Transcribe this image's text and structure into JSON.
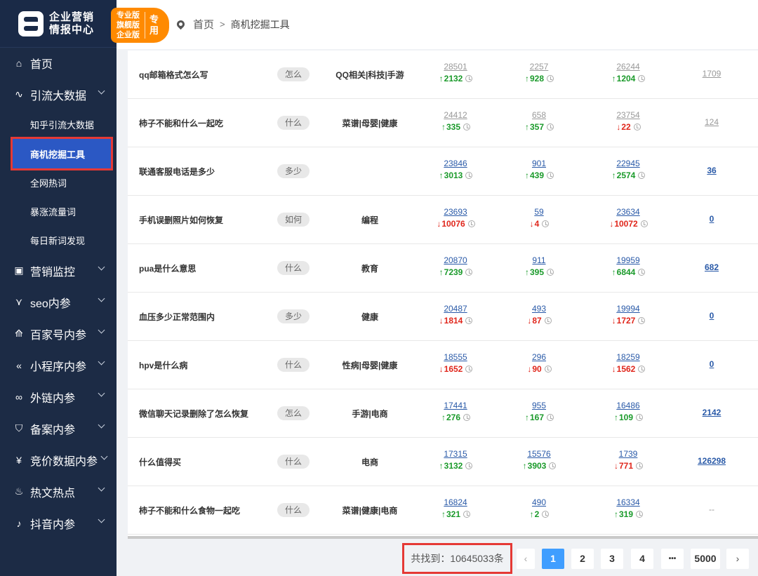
{
  "brand": {
    "line1": "企业营销",
    "line2": "情报中心",
    "edition_lines": [
      "专业版",
      "旗舰版",
      "企业版"
    ],
    "edition_label": "专用"
  },
  "breadcrumb": {
    "home": "首页",
    "separator": ">",
    "current": "商机挖掘工具"
  },
  "sidebar": {
    "home": {
      "label": "首页",
      "icon": "home-icon"
    },
    "group1": {
      "label": "引流大数据",
      "icon": "pulse-icon",
      "subitems": [
        "知乎引流大数据",
        "商机挖掘工具",
        "全网热词",
        "暴涨流量词",
        "每日新词发现"
      ]
    },
    "groups": [
      {
        "label": "营销监控",
        "icon": "monitor-icon"
      },
      {
        "label": "seo内参",
        "icon": "seo-icon"
      },
      {
        "label": "百家号内参",
        "icon": "baijia-icon"
      },
      {
        "label": "小程序内参",
        "icon": "miniapp-icon"
      },
      {
        "label": "外链内参",
        "icon": "link-icon"
      },
      {
        "label": "备案内参",
        "icon": "shield-icon"
      },
      {
        "label": "竞价数据内参",
        "icon": "yuan-icon"
      },
      {
        "label": "热文热点",
        "icon": "fire-icon"
      },
      {
        "label": "抖音内参",
        "icon": "douyin-icon"
      }
    ]
  },
  "rows": [
    {
      "keyword": "qq邮箱格式怎么写",
      "tag": "怎么",
      "category": "QQ相关|科技|手游",
      "m1": "28501",
      "d1": "2132",
      "d1dir": "up",
      "m2": "2257",
      "d2": "928",
      "d2dir": "up",
      "m3": "26244",
      "d3": "1204",
      "d3dir": "up",
      "last": "1709",
      "grey": true
    },
    {
      "keyword": "柿子不能和什么一起吃",
      "tag": "什么",
      "category": "菜谱|母婴|健康",
      "m1": "24412",
      "d1": "335",
      "d1dir": "up",
      "m2": "658",
      "d2": "357",
      "d2dir": "up",
      "m3": "23754",
      "d3": "22",
      "d3dir": "down",
      "last": "124",
      "grey": true
    },
    {
      "keyword": "联通客服电话是多少",
      "tag": "多少",
      "category": "",
      "m1": "23846",
      "d1": "3013",
      "d1dir": "up",
      "m2": "901",
      "d2": "439",
      "d2dir": "up",
      "m3": "22945",
      "d3": "2574",
      "d3dir": "up",
      "last": "36",
      "grey": false
    },
    {
      "keyword": "手机误删照片如何恢复",
      "tag": "如何",
      "category": "编程",
      "m1": "23693",
      "d1": "10076",
      "d1dir": "down",
      "m2": "59",
      "d2": "4",
      "d2dir": "down",
      "m3": "23634",
      "d3": "10072",
      "d3dir": "down",
      "last": "0",
      "grey": false
    },
    {
      "keyword": "pua是什么意思",
      "tag": "什么",
      "category": "教育",
      "m1": "20870",
      "d1": "7239",
      "d1dir": "up",
      "m2": "911",
      "d2": "395",
      "d2dir": "up",
      "m3": "19959",
      "d3": "6844",
      "d3dir": "up",
      "last": "682",
      "grey": false
    },
    {
      "keyword": "血压多少正常范围内",
      "tag": "多少",
      "category": "健康",
      "m1": "20487",
      "d1": "1814",
      "d1dir": "down",
      "m2": "493",
      "d2": "87",
      "d2dir": "down",
      "m3": "19994",
      "d3": "1727",
      "d3dir": "down",
      "last": "0",
      "grey": false
    },
    {
      "keyword": "hpv是什么病",
      "tag": "什么",
      "category": "性病|母婴|健康",
      "m1": "18555",
      "d1": "1652",
      "d1dir": "down",
      "m2": "296",
      "d2": "90",
      "d2dir": "down",
      "m3": "18259",
      "d3": "1562",
      "d3dir": "down",
      "last": "0",
      "grey": false
    },
    {
      "keyword": "微信聊天记录删除了怎么恢复",
      "tag": "怎么",
      "category": "手游|电商",
      "m1": "17441",
      "d1": "276",
      "d1dir": "up",
      "m2": "955",
      "d2": "167",
      "d2dir": "up",
      "m3": "16486",
      "d3": "109",
      "d3dir": "up",
      "last": "2142",
      "grey": false
    },
    {
      "keyword": "什么值得买",
      "tag": "什么",
      "category": "电商",
      "m1": "17315",
      "d1": "3132",
      "d1dir": "up",
      "m2": "15576",
      "d2": "3903",
      "d2dir": "up",
      "m3": "1739",
      "d3": "771",
      "d3dir": "down",
      "last": "126298",
      "grey": false
    },
    {
      "keyword": "柿子不能和什么食物一起吃",
      "tag": "什么",
      "category": "菜谱|健康|电商",
      "m1": "16824",
      "d1": "321",
      "d1dir": "up",
      "m2": "490",
      "d2": "2",
      "d2dir": "up",
      "m3": "16334",
      "d3": "319",
      "d3dir": "up",
      "last": "--",
      "grey": false,
      "none": true
    }
  ],
  "pagination": {
    "total_text": "共找到：10645033条",
    "prev": "‹",
    "pages": [
      "1",
      "2",
      "3",
      "4"
    ],
    "ellipsis": "•••",
    "last_page": "5000",
    "next": "›",
    "current": "1"
  },
  "colors": {
    "sidebar": "#1c2b45",
    "active": "#2b58c4",
    "up": "#1a9a2a",
    "down": "#e0261b",
    "highlight": "#e53935",
    "page_active": "#409eff"
  }
}
